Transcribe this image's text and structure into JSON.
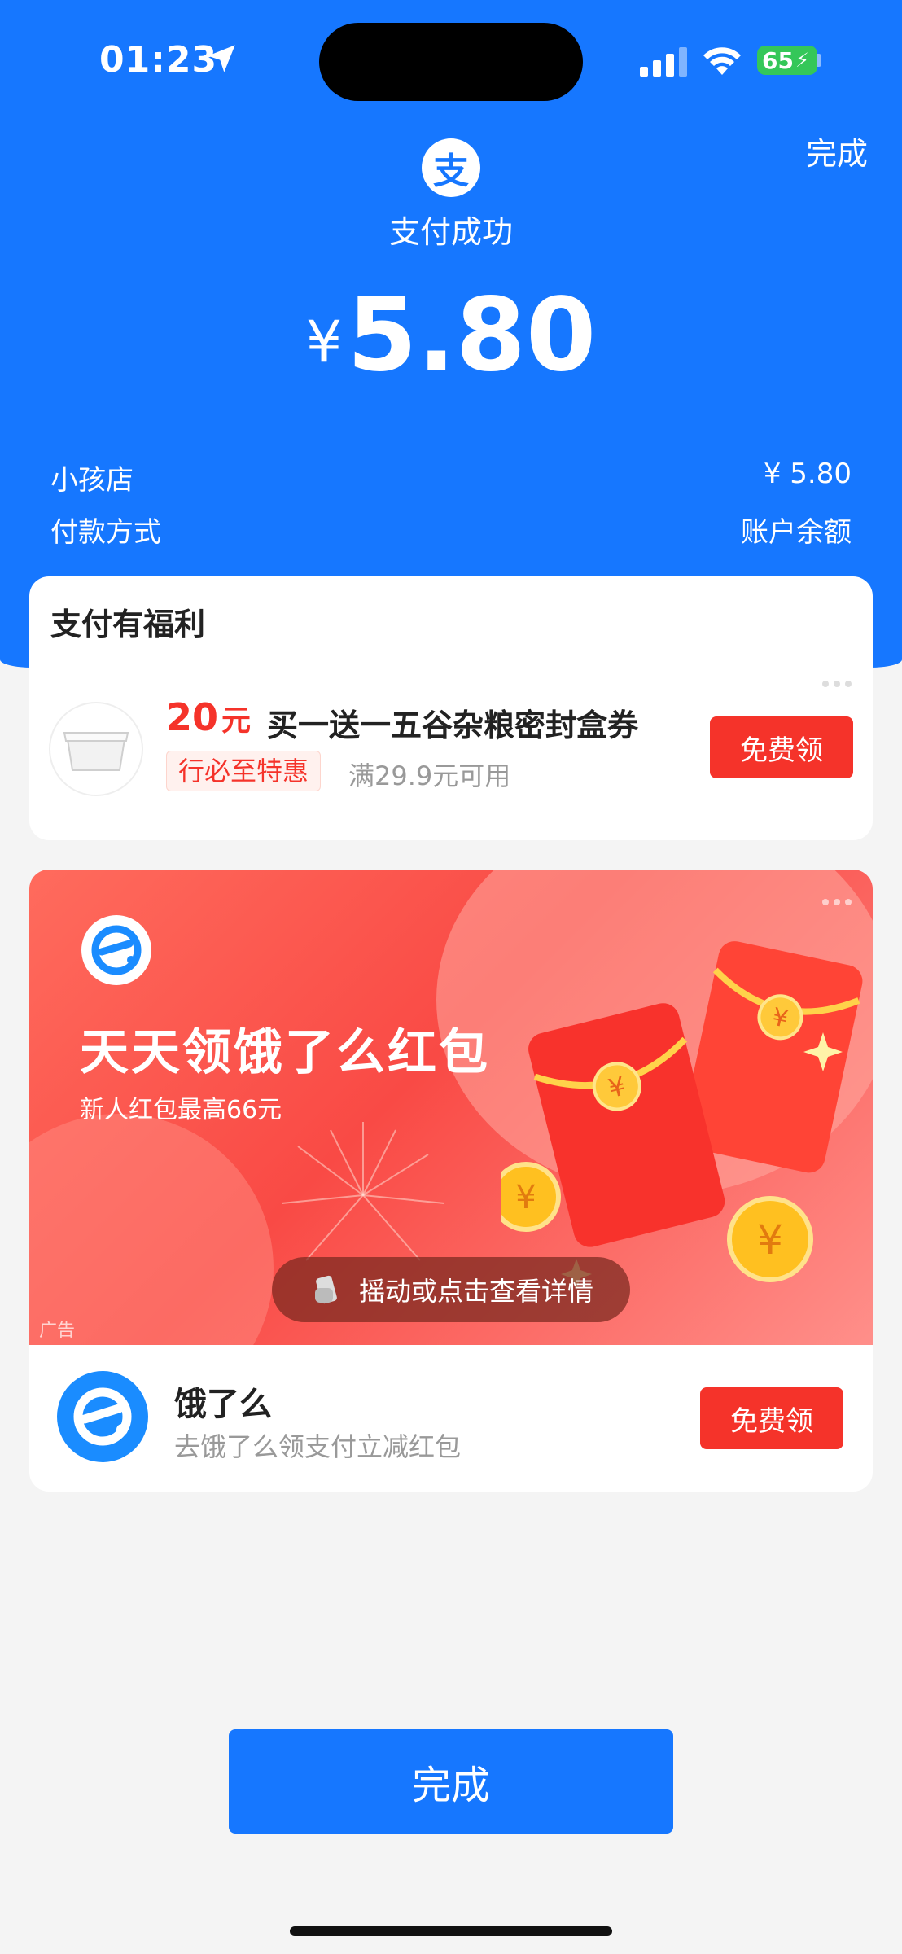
{
  "status_bar": {
    "time": "01:23",
    "battery": "65"
  },
  "header": {
    "done_label": "完成",
    "logo_char": "支",
    "status_text": "支付成功",
    "currency": "¥",
    "amount": "5.80"
  },
  "details": {
    "merchant_label": "小孩店",
    "merchant_value": "¥ 5.80",
    "method_label": "付款方式",
    "method_value": "账户余额"
  },
  "benefit": {
    "title": "支付有福利",
    "coupon_amount": "20",
    "coupon_unit": "元",
    "coupon_title": "买一送一五谷杂粮密封盒券",
    "tag": "行必至特惠",
    "condition": "满29.9元可用",
    "button": "免费领"
  },
  "ad": {
    "banner_title": "天天领饿了么红包",
    "banner_sub": "新人红包最高66元",
    "shake_text": "摇动或点击查看详情",
    "ad_label": "广告",
    "app_name": "饿了么",
    "app_desc": "去饿了么领支付立减红包",
    "button": "免费领"
  },
  "footer": {
    "done_label": "完成"
  },
  "colors": {
    "primary": "#1677ff",
    "accent_red": "#f5332a",
    "page_bg": "#f4f4f4"
  }
}
